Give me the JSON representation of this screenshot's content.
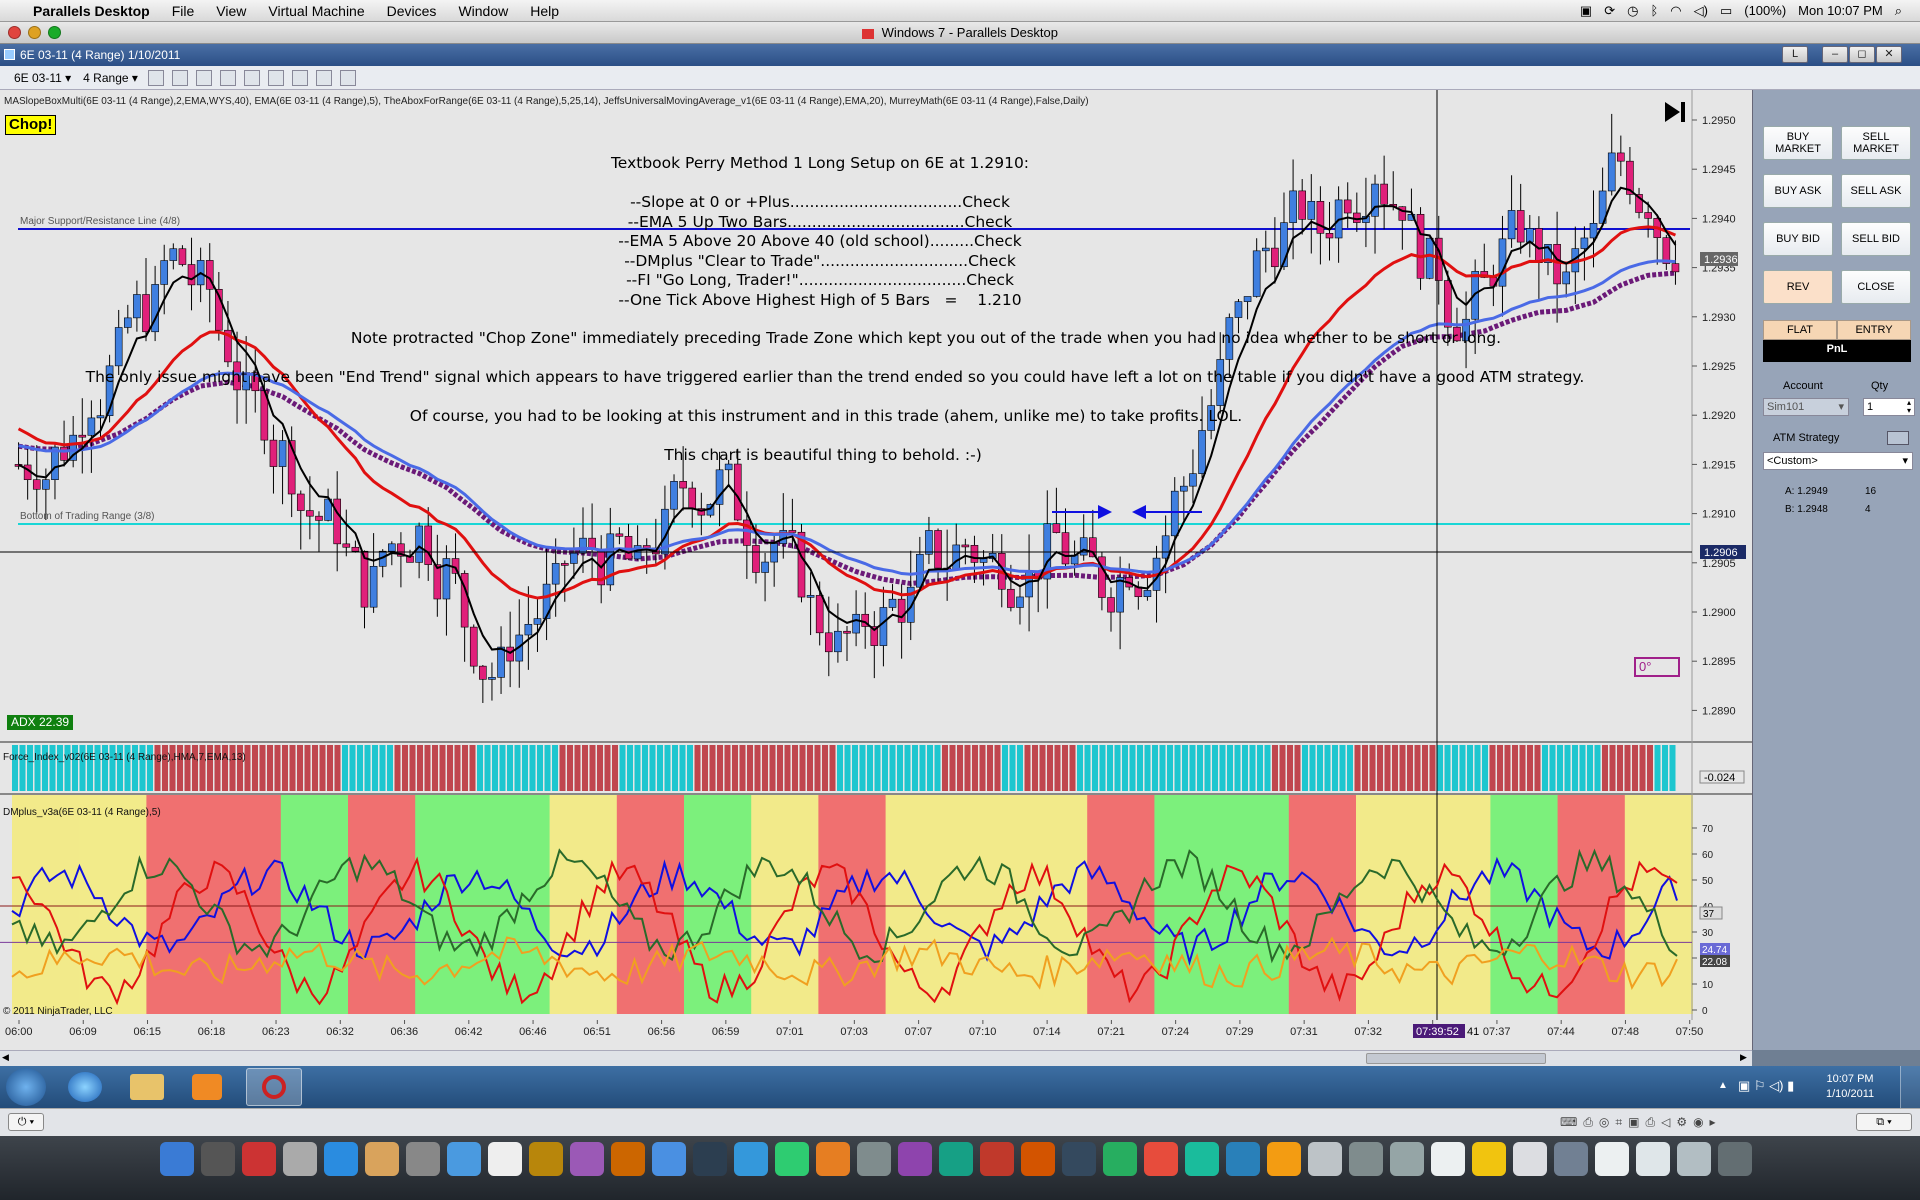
{
  "mac_menu": {
    "apple": "",
    "app": "Parallels Desktop",
    "items": [
      "File",
      "View",
      "Virtual Machine",
      "Devices",
      "Window",
      "Help"
    ],
    "battery": "(100%)",
    "clock": "Mon 10:07 PM"
  },
  "parallels_title": "Windows 7 - Parallels Desktop",
  "window": {
    "title": "6E 03-11 (4 Range)  1/10/2011",
    "btn_l": "L",
    "btn_min": "–",
    "btn_max": "◻",
    "btn_close": "✕"
  },
  "toolbar": {
    "instrument": "6E 03-11",
    "period": "4 Range"
  },
  "chart": {
    "indicator_header": "MASlopeBoxMulti(6E 03-11 (4 Range),2,EMA,WYS,40), EMA(6E 03-11 (4 Range),5), TheAboxForRange(6E 03-11 (4 Range),5,25,14), JeffsUniversalMovingAverage_v1(6E 03-11 (4 Range),EMA,20), MurreyMath(6E 03-11 (4 Range),False,Daily)",
    "chop_label": "Chop!",
    "major_line_label": "Major Support/Resistance Line (4/8)",
    "bottom_line_label": "Bottom of Trading Range (3/8)",
    "adx_label": "ADX 22.39",
    "zero_box": "0°",
    "annotation_lines": [
      "Textbook Perry Method 1 Long Setup on 6E at 1.2910:",
      "",
      "--Slope at 0 or +Plus...................................Check",
      "--EMA 5 Up Two Bars....................................Check",
      "--EMA 5 Above 20 Above 40 (old school).........Check",
      "--DMplus \"Clear to Trade\"..............................Check",
      "--FI \"Go Long, Trader!\"..................................Check",
      "--One Tick Above Highest High of 5 Bars   =    1.210"
    ],
    "note1": "Note protracted \"Chop Zone\" immediately preceding Trade Zone which kept you out of the trade when you had no idea whether to be short or long.",
    "note2": "The only issue might have been \"End Trend\" signal which appears to have triggered earlier than the trend ended so you could have left a lot on the table if you didn't have a good ATM strategy.",
    "note3": "Of course, you had to be looking at this instrument and in this trade (ahem, unlike me) to take profits.  LOL.",
    "note4": "This chart is beautiful thing to behold. :-)",
    "price_ticks": [
      "1.2950",
      "1.2945",
      "1.2940",
      "1.2935",
      "1.2930",
      "1.2925",
      "1.2920",
      "1.2915",
      "1.2910",
      "1.2905",
      "1.2900",
      "1.2895",
      "1.2890"
    ],
    "last_price": "1.2936",
    "crosshair_price": "1.2906",
    "force_index_label": "Force_Index_v02(6E 03-11 (4 Range),HMA,7,EMA,13)",
    "force_index_value": "-0.024",
    "dmplus_label": "DMplus_v3a(6E 03-11 (4 Range),5)",
    "dm_ticks": [
      "70",
      "60",
      "50",
      "40",
      "30",
      "20",
      "10",
      "0"
    ],
    "dm_values": [
      "37",
      "24.74",
      "22.08"
    ],
    "copyright": "© 2011 NinjaTrader, LLC",
    "time_ticks": [
      "06:00",
      "06:09",
      "06:15",
      "06:18",
      "06:23",
      "06:32",
      "06:36",
      "06:42",
      "06:46",
      "06:51",
      "06:56",
      "06:59",
      "07:01",
      "07:03",
      "07:07",
      "07:10",
      "07:14",
      "07:21",
      "07:24",
      "07:29",
      "07:31",
      "07:32",
      "07:34",
      "07:37",
      "07:44",
      "07:48",
      "07:50"
    ],
    "crosshair_time": "07:39:52",
    "crosshair_time_suffix": "41"
  },
  "chart_data": {
    "type": "candlestick",
    "title": "",
    "price_range": [
      1.2887,
      1.2953
    ],
    "close_prices": [
      1.2915,
      1.2917,
      1.2922,
      1.2926,
      1.2931,
      1.2936,
      1.2933,
      1.2927,
      1.2921,
      1.2916,
      1.291,
      1.2909,
      1.2903,
      1.2907,
      1.2908,
      1.2904,
      1.2897,
      1.2894,
      1.2899,
      1.2902,
      1.2906,
      1.2905,
      1.2904,
      1.2908,
      1.2913,
      1.2913,
      1.2909,
      1.2907,
      1.2904,
      1.2898,
      1.2897,
      1.2899,
      1.2901,
      1.2906,
      1.2907,
      1.2905,
      1.2904,
      1.2906,
      1.2905,
      1.2903,
      1.2905,
      1.2906,
      1.2913,
      1.2921,
      1.293,
      1.2937,
      1.294,
      1.2939,
      1.2943,
      1.2945,
      1.2942,
      1.2935,
      1.293,
      1.2933,
      1.2938,
      1.2937,
      1.2933,
      1.2938,
      1.2946,
      1.2942,
      1.2937
    ]
  },
  "right_panel": {
    "buy_market": "BUY MARKET",
    "sell_market": "SELL MARKET",
    "buy_ask": "BUY ASK",
    "sell_ask": "SELL ASK",
    "buy_bid": "BUY BID",
    "sell_bid": "SELL BID",
    "rev": "REV",
    "close": "CLOSE",
    "flat": "FLAT",
    "entry": "ENTRY",
    "pnl": "PnL",
    "account_label": "Account",
    "qty_label": "Qty",
    "account_value": "Sim101",
    "qty_value": "1",
    "atm_label": "ATM Strategy",
    "atm_value": "<Custom>",
    "ask_line": "A: 1.2949",
    "ask_qty": "16",
    "bid_line": "B: 1.2948",
    "bid_qty": "4"
  },
  "taskbar": {
    "time": "10:07 PM",
    "date": "1/10/2011"
  }
}
